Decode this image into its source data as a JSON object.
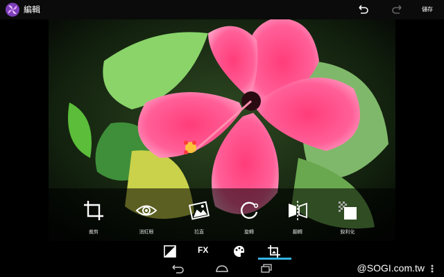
{
  "header": {
    "title": "編輯",
    "save_label": "儲存"
  },
  "tools": [
    {
      "label": "裁剪",
      "icon": "crop-icon"
    },
    {
      "label": "消紅眼",
      "icon": "eye-icon"
    },
    {
      "label": "拉直",
      "icon": "straighten-icon"
    },
    {
      "label": "旋轉",
      "icon": "rotate-icon"
    },
    {
      "label": "翻轉",
      "icon": "mirror-icon"
    },
    {
      "label": "銳利化",
      "icon": "sharpen-icon"
    }
  ],
  "bottom_tabs": {
    "fx_label": "FX",
    "active_color": "#33b5e5"
  },
  "watermark": "@SOGI.com.tw"
}
